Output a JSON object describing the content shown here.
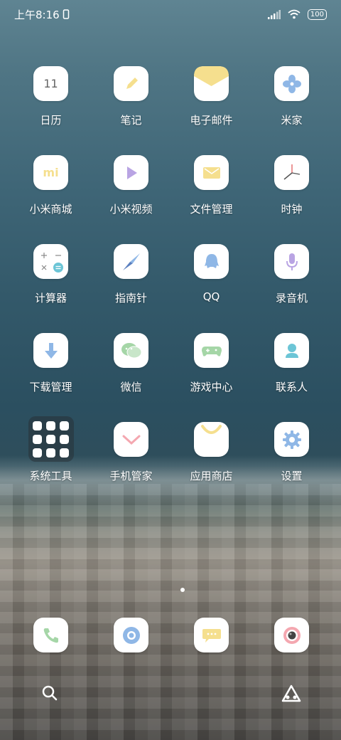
{
  "status_bar": {
    "time": "上午8:16",
    "battery": "100"
  },
  "apps": [
    {
      "label": "日历",
      "icon": "calendar-icon",
      "icon_text": "11"
    },
    {
      "label": "笔记",
      "icon": "notes-icon"
    },
    {
      "label": "电子邮件",
      "icon": "email-icon"
    },
    {
      "label": "米家",
      "icon": "mijia-icon"
    },
    {
      "label": "小米商城",
      "icon": "mi-store-icon",
      "icon_text": "mi"
    },
    {
      "label": "小米视频",
      "icon": "mi-video-icon"
    },
    {
      "label": "文件管理",
      "icon": "file-manager-icon"
    },
    {
      "label": "时钟",
      "icon": "clock-icon"
    },
    {
      "label": "计算器",
      "icon": "calculator-icon"
    },
    {
      "label": "指南针",
      "icon": "compass-icon"
    },
    {
      "label": "QQ",
      "icon": "qq-icon"
    },
    {
      "label": "录音机",
      "icon": "recorder-icon"
    },
    {
      "label": "下载管理",
      "icon": "download-icon"
    },
    {
      "label": "微信",
      "icon": "wechat-icon"
    },
    {
      "label": "游戏中心",
      "icon": "game-center-icon"
    },
    {
      "label": "联系人",
      "icon": "contacts-icon"
    },
    {
      "label": "系统工具",
      "icon": "system-tools-folder-icon"
    },
    {
      "label": "手机管家",
      "icon": "security-icon"
    },
    {
      "label": "应用商店",
      "icon": "app-store-icon"
    },
    {
      "label": "设置",
      "icon": "settings-icon"
    }
  ],
  "dock": [
    {
      "icon": "phone-icon"
    },
    {
      "icon": "browser-icon"
    },
    {
      "icon": "messages-icon"
    },
    {
      "icon": "camera-icon"
    }
  ],
  "bottom_nav": {
    "search": "search-icon",
    "assistant": "assistant-icon"
  },
  "colors": {
    "icon_bg": "#ffffff",
    "yellow": "#f5df8e",
    "purple": "#b9a4e3",
    "blue": "#8fb7e6",
    "green": "#a5d6a7",
    "teal": "#6cc5d6"
  }
}
